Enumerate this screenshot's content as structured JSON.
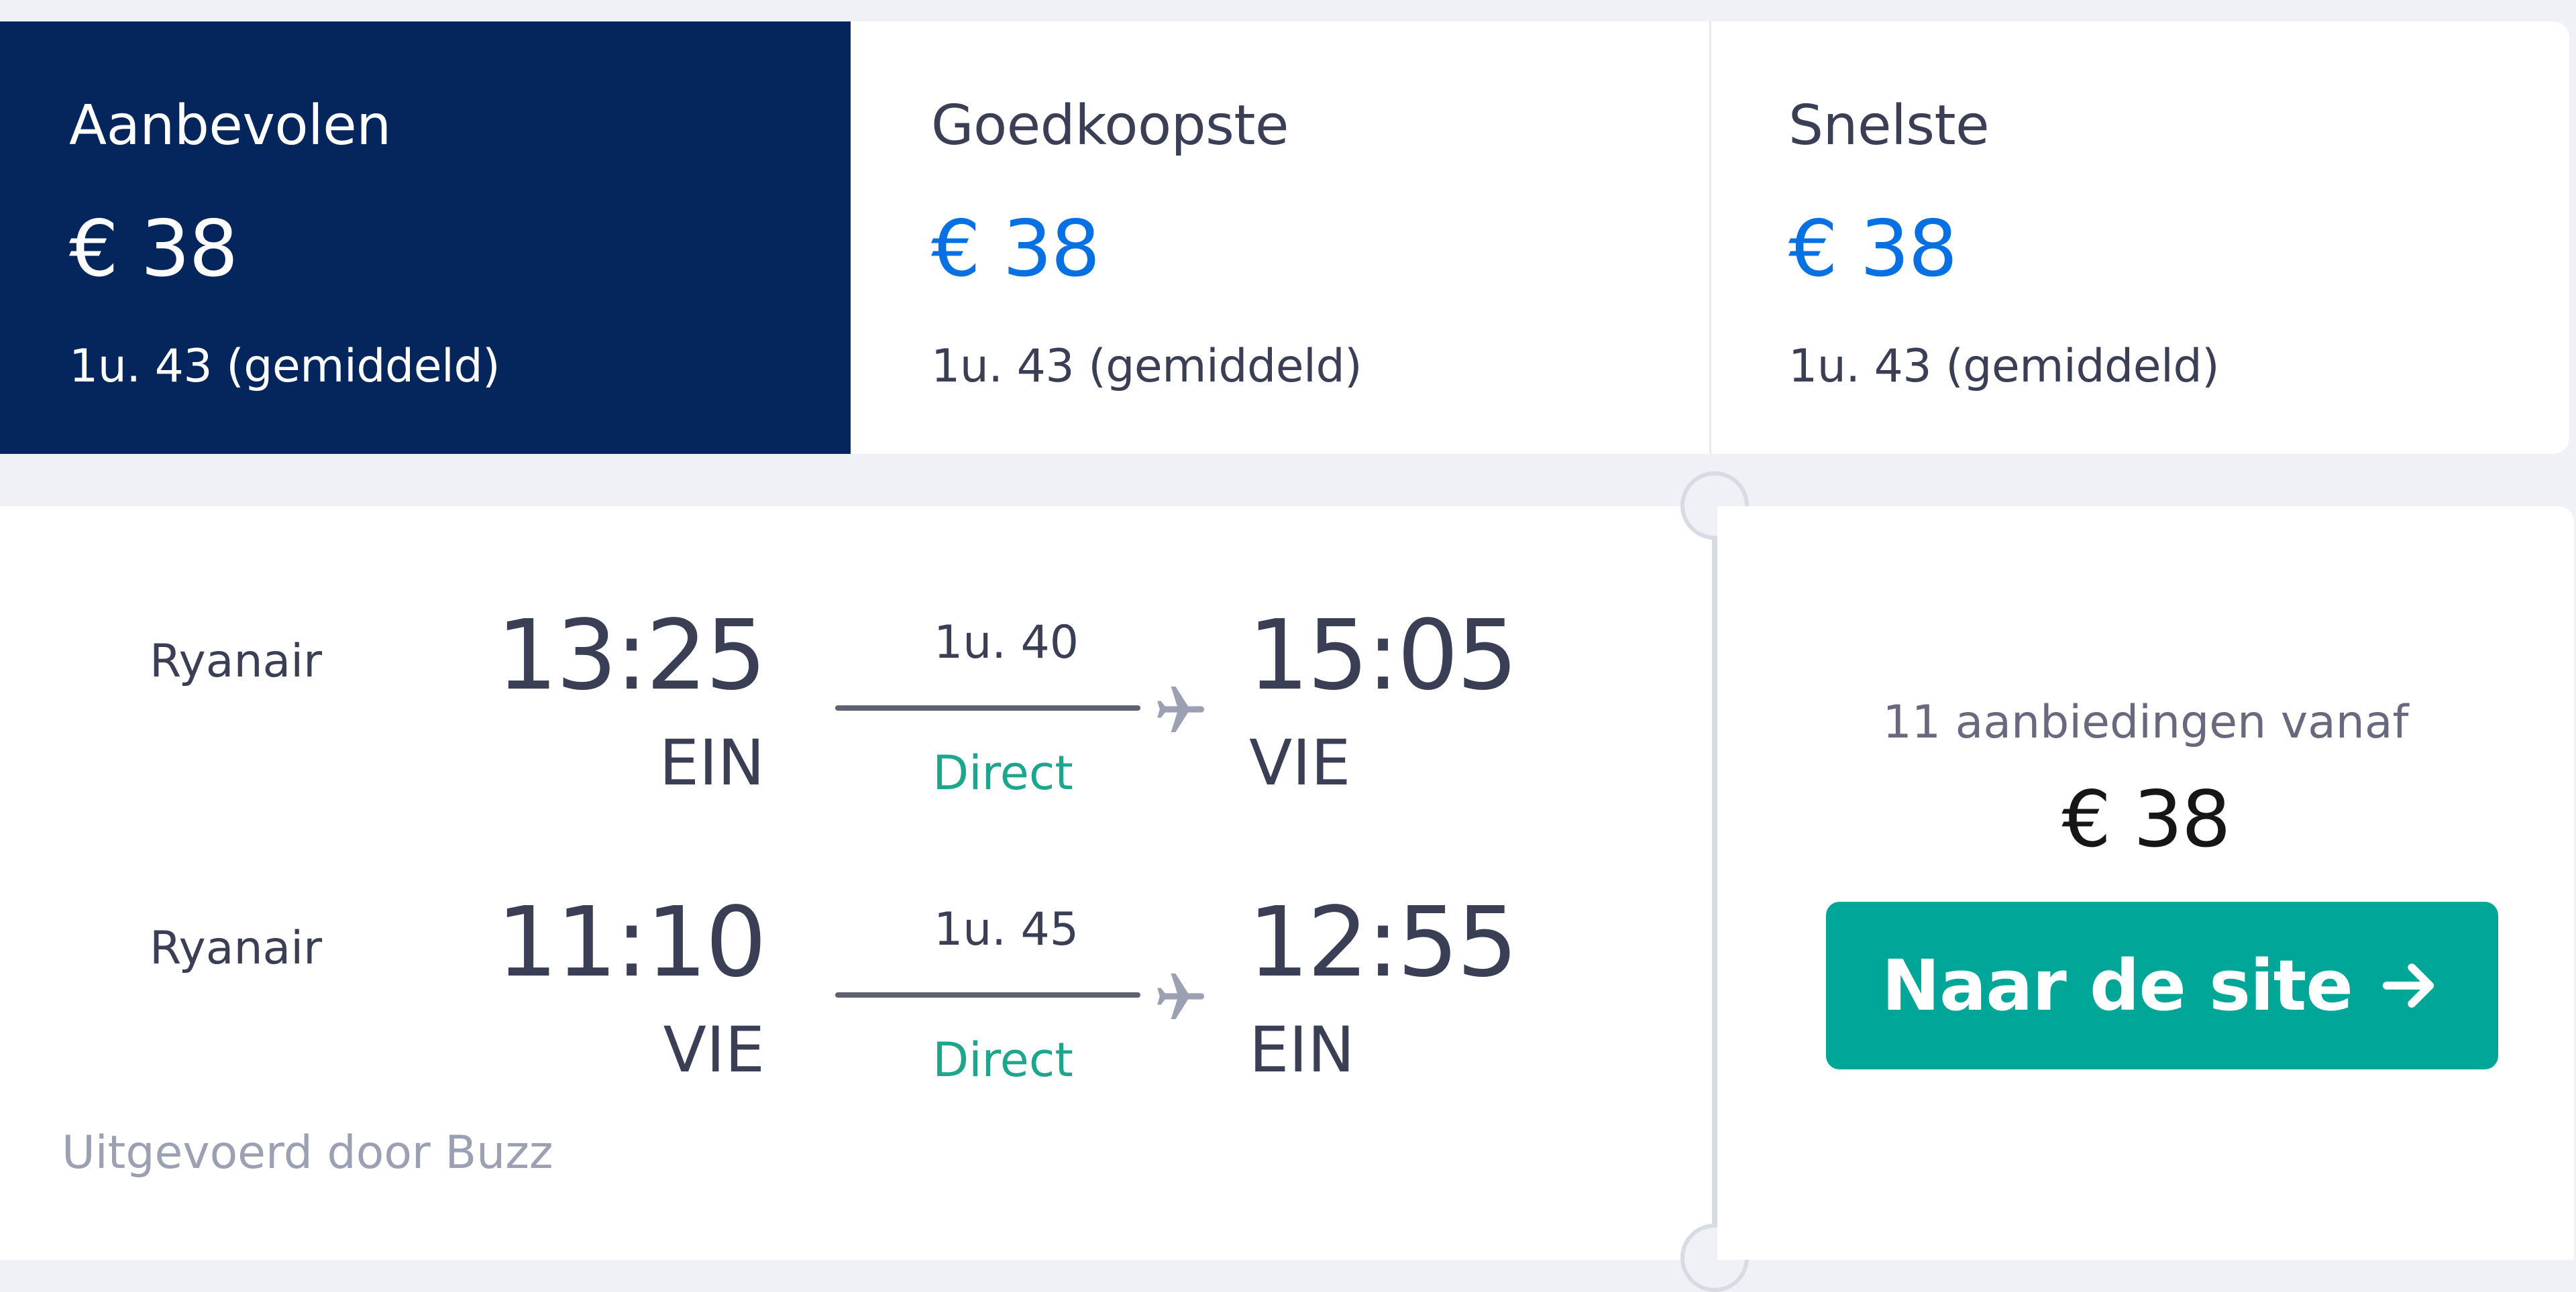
{
  "sort_tabs": [
    {
      "label": "Aanbevolen",
      "price": "€ 38",
      "duration": "1u. 43 (gemiddeld)",
      "selected": true
    },
    {
      "label": "Goedkoopste",
      "price": "€ 38",
      "duration": "1u. 43 (gemiddeld)",
      "selected": false
    },
    {
      "label": "Snelste",
      "price": "€ 38",
      "duration": "1u. 43 (gemiddeld)",
      "selected": false
    }
  ],
  "legs": [
    {
      "airline": "Ryanair",
      "departure_time": "13:25",
      "departure_code": "EIN",
      "duration": "1u. 40",
      "stops": "Direct",
      "arrival_time": "15:05",
      "arrival_code": "VIE"
    },
    {
      "airline": "Ryanair",
      "departure_time": "11:10",
      "departure_code": "VIE",
      "duration": "1u. 45",
      "stops": "Direct",
      "arrival_time": "12:55",
      "arrival_code": "EIN"
    }
  ],
  "operated_by": "Uitgevoerd door Buzz",
  "deals": {
    "text": "11 aanbiedingen vanaf",
    "price": "€ 38",
    "button_label": "Naar de site"
  },
  "icons": {
    "leg_icon": "plane-icon",
    "button_icon": "arrow-right-icon"
  },
  "colors": {
    "selected_tab_bg": "#05265c",
    "price_blue": "#0770e3",
    "direct_green": "#1ba68d",
    "cta_bg": "#00a698",
    "page_bg": "#eff1f6"
  }
}
